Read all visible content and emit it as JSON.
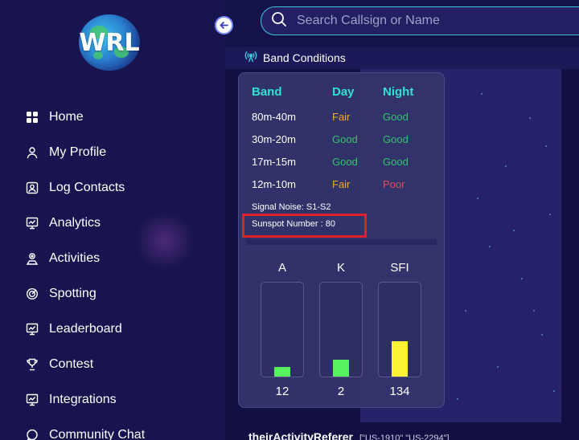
{
  "logo": {
    "text": "WRL"
  },
  "search": {
    "placeholder": "Search Callsign or Name"
  },
  "nav": {
    "items": [
      {
        "label": "Home",
        "icon": "grid-icon"
      },
      {
        "label": "My Profile",
        "icon": "user-icon"
      },
      {
        "label": "Log Contacts",
        "icon": "contact-card-icon"
      },
      {
        "label": "Analytics",
        "icon": "chart-board-icon"
      },
      {
        "label": "Activities",
        "icon": "activity-icon"
      },
      {
        "label": "Spotting",
        "icon": "target-icon"
      },
      {
        "label": "Leaderboard",
        "icon": "board-icon"
      },
      {
        "label": "Contest",
        "icon": "trophy-icon"
      },
      {
        "label": "Integrations",
        "icon": "integration-icon"
      },
      {
        "label": "Community Chat",
        "icon": "chat-icon"
      }
    ]
  },
  "section": {
    "title": "Band Conditions"
  },
  "band_table": {
    "headers": {
      "band": "Band",
      "day": "Day",
      "night": "Night"
    },
    "rows": [
      {
        "band": "80m-40m",
        "day": "Fair",
        "night": "Good"
      },
      {
        "band": "30m-20m",
        "day": "Good",
        "night": "Good"
      },
      {
        "band": "17m-15m",
        "day": "Good",
        "night": "Good"
      },
      {
        "band": "12m-10m",
        "day": "Fair",
        "night": "Poor"
      }
    ]
  },
  "signal_noise": "Signal Noise: S1-S2",
  "sunspot": "Sunspot Number : 80",
  "meters": [
    {
      "label": "A",
      "value": "12",
      "fraction": 0.1,
      "color": "#57f25e"
    },
    {
      "label": "K",
      "value": "2",
      "fraction": 0.18,
      "color": "#57f25e"
    },
    {
      "label": "SFI",
      "value": "134",
      "fraction": 0.38,
      "color": "#fbf233"
    }
  ],
  "bottom": {
    "title": "theirActivityReferer",
    "tags": "[\"US-1910\" \"US-2294\"]"
  },
  "colors": {
    "accent_cyan": "#3ec7d6",
    "header_cyan": "#30e0d0",
    "fair": "#f0a92a",
    "good": "#33c46a",
    "poor": "#e0505a",
    "highlight_red": "#e0202c"
  }
}
